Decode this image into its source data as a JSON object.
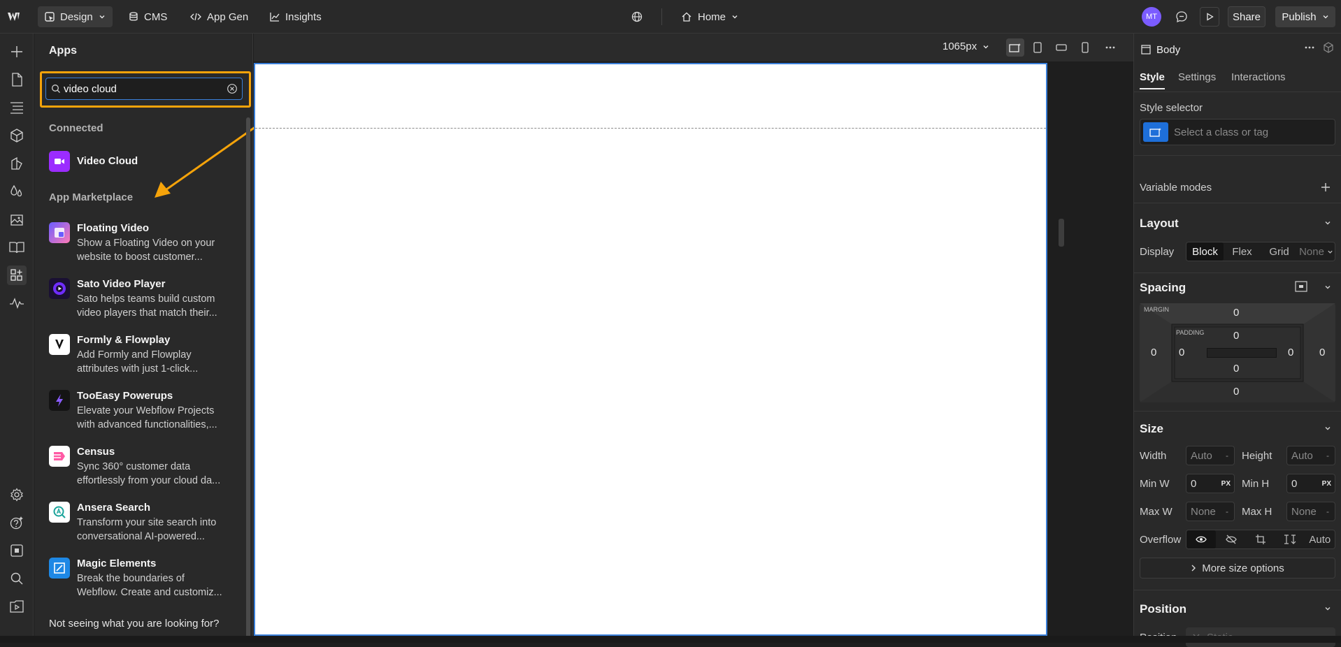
{
  "topbar": {
    "design": "Design",
    "cms": "CMS",
    "app_gen": "App Gen",
    "insights": "Insights",
    "page": "Home",
    "avatar": "MT",
    "share": "Share",
    "publish": "Publish"
  },
  "apps": {
    "title": "Apps",
    "search_value": "video cloud",
    "connected_heading": "Connected",
    "connected_item": "Video Cloud",
    "marketplace_heading": "App Marketplace",
    "items": [
      {
        "name": "Floating Video",
        "line1": "Show a Floating Video on your",
        "line2": "website to boost customer..."
      },
      {
        "name": "Sato Video Player",
        "line1": "Sato helps teams build custom",
        "line2": "video players that match their..."
      },
      {
        "name": "Formly & Flowplay",
        "line1": "Add Formly and Flowplay",
        "line2": "attributes with just 1-click..."
      },
      {
        "name": "TooEasy Powerups",
        "line1": "Elevate your Webflow Projects",
        "line2": "with advanced functionalities,..."
      },
      {
        "name": "Census",
        "line1": "Sync 360° customer data",
        "line2": "effortlessly from your cloud da..."
      },
      {
        "name": "Ansera Search",
        "line1": "Transform your site search into",
        "line2": "conversational AI-powered..."
      },
      {
        "name": "Magic Elements",
        "line1": "Break the boundaries of",
        "line2": "Webflow. Create and customiz..."
      }
    ],
    "footer": "Not seeing what you are looking for?"
  },
  "canvas": {
    "width_label": "1065px"
  },
  "panel": {
    "element": "Body",
    "tabs": [
      "Style",
      "Settings",
      "Interactions"
    ],
    "style_selector_label": "Style selector",
    "style_selector_placeholder": "Select a class or tag",
    "variable_modes": "Variable modes",
    "layout": "Layout",
    "display_label": "Display",
    "display_options": [
      "Block",
      "Flex",
      "Grid",
      "None"
    ],
    "spacing": "Spacing",
    "margin_label": "MARGIN",
    "padding_label": "PADDING",
    "zero": "0",
    "size": "Size",
    "width_label": "Width",
    "height_label": "Height",
    "auto": "Auto",
    "min_w": "Min W",
    "min_h": "Min H",
    "px": "PX",
    "max_w": "Max W",
    "max_h": "Max H",
    "none": "None",
    "dash": "-",
    "overflow": "Overflow",
    "overflow_auto": "Auto",
    "more_size": "More size options",
    "position": "Position",
    "position_label": "Position",
    "position_value": "Static"
  },
  "colors": {
    "highlight": "#f5a30a",
    "accent": "#3a7fd9",
    "avatar": "#7b5cff",
    "video_cloud": "#9b2cff"
  }
}
